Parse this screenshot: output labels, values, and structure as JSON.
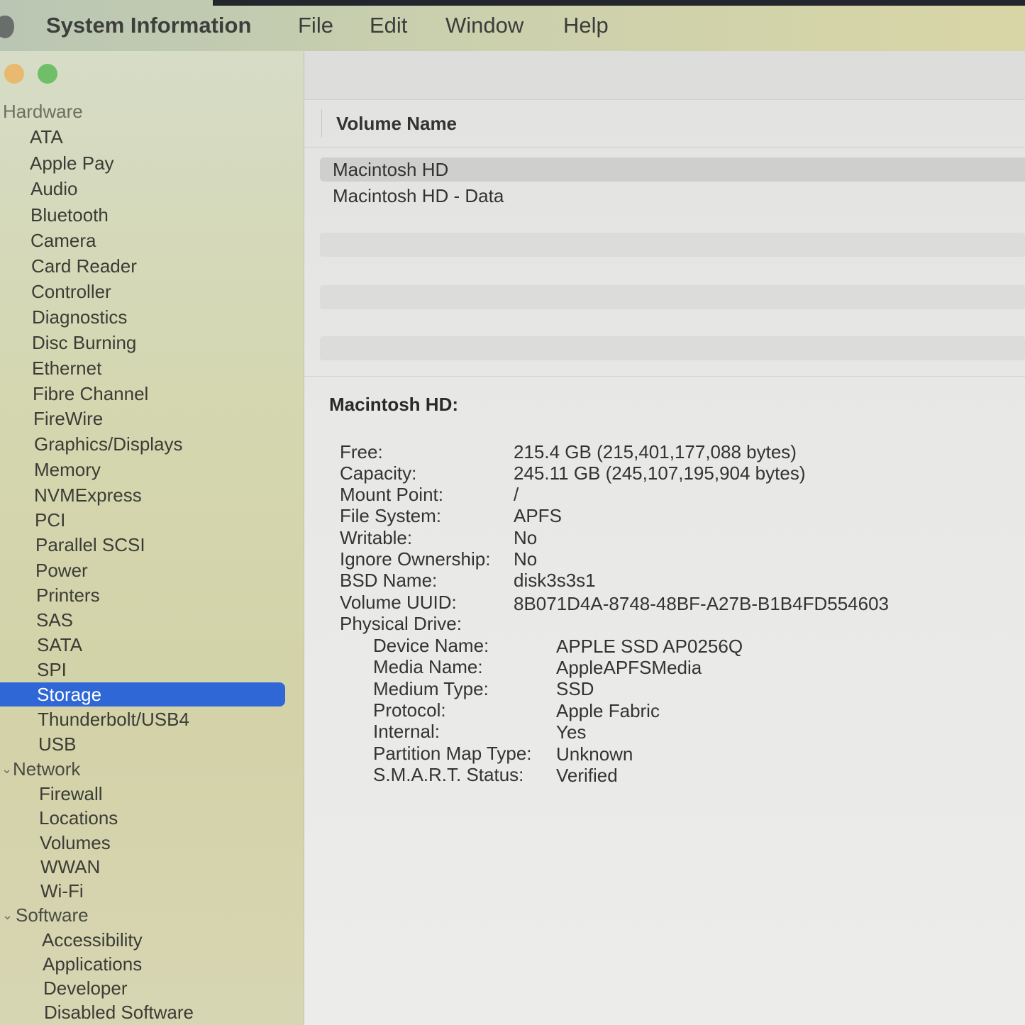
{
  "menubar": {
    "app_name": "System Information",
    "items": [
      "File",
      "Edit",
      "Window",
      "Help"
    ]
  },
  "sidebar": {
    "hardware_label": "Hardware",
    "hardware_items": [
      "ATA",
      "Apple Pay",
      "Audio",
      "Bluetooth",
      "Camera",
      "Card Reader",
      "Controller",
      "Diagnostics",
      "Disc Burning",
      "Ethernet",
      "Fibre Channel",
      "FireWire",
      "Graphics/Displays",
      "Memory",
      "NVMExpress",
      "PCI",
      "Parallel SCSI",
      "Power",
      "Printers",
      "SAS",
      "SATA",
      "SPI",
      "Storage",
      "Thunderbolt/USB4",
      "USB"
    ],
    "selected_item": "Storage",
    "network_label": "Network",
    "network_items": [
      "Firewall",
      "Locations",
      "Volumes",
      "WWAN",
      "Wi-Fi"
    ],
    "software_label": "Software",
    "software_items": [
      "Accessibility",
      "Applications",
      "Developer",
      "Disabled Software"
    ]
  },
  "main": {
    "column_header": "Volume Name",
    "volumes": [
      "Macintosh HD",
      "Macintosh HD - Data"
    ],
    "detail_title": "Macintosh HD:",
    "details": [
      {
        "key": "Free:",
        "value": "215.4 GB (215,401,177,088 bytes)"
      },
      {
        "key": "Capacity:",
        "value": "245.11 GB (245,107,195,904 bytes)"
      },
      {
        "key": "Mount Point:",
        "value": "/"
      },
      {
        "key": "File System:",
        "value": "APFS"
      },
      {
        "key": "Writable:",
        "value": "No"
      },
      {
        "key": "Ignore Ownership:",
        "value": "No"
      },
      {
        "key": "BSD Name:",
        "value": "disk3s3s1"
      },
      {
        "key": "Volume UUID:",
        "value": "8B071D4A-8748-48BF-A27B-B1B4FD554603"
      },
      {
        "key": "Physical Drive:",
        "value": ""
      }
    ],
    "physical_drive": [
      {
        "key": "Device Name:",
        "value": "APPLE SSD AP0256Q"
      },
      {
        "key": "Media Name:",
        "value": "AppleAPFSMedia"
      },
      {
        "key": "Medium Type:",
        "value": "SSD"
      },
      {
        "key": "Protocol:",
        "value": "Apple Fabric"
      },
      {
        "key": "Internal:",
        "value": "Yes"
      },
      {
        "key": "Partition Map Type:",
        "value": "Unknown"
      },
      {
        "key": "S.M.A.R.T. Status:",
        "value": "Verified"
      }
    ]
  },
  "colors": {
    "selection": "#2f67d6",
    "close_dot": "#e8b96e",
    "zoom_dot": "#6ebf67"
  }
}
